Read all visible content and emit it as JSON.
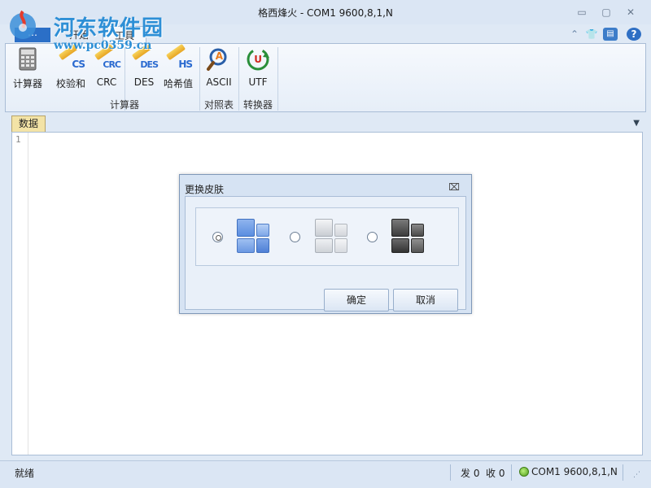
{
  "window": {
    "title": "格西烽火 - COM1  9600,8,1,N",
    "controls": {
      "minimize": "▭",
      "restore": "▢",
      "close": "✕"
    }
  },
  "watermark": {
    "title": "河东软件园",
    "url": "www.pc0359.cn"
  },
  "app_menu": {
    "label": "⋯"
  },
  "ribbon_tabs": [
    {
      "label": "开始",
      "active": false
    },
    {
      "label": "工具",
      "active": true
    }
  ],
  "ribbon_right": [
    {
      "icon": "chevron-up-icon",
      "glyph": "⌃"
    },
    {
      "icon": "shirt-icon",
      "glyph": "👕"
    },
    {
      "icon": "chat-icon",
      "glyph": "▤"
    },
    {
      "icon": "help-icon",
      "glyph": "?"
    }
  ],
  "ribbon": {
    "groups": [
      {
        "label": "计算器"
      },
      {
        "label": "对照表"
      },
      {
        "label": "转换器"
      }
    ],
    "buttons": [
      {
        "label": "计算器",
        "icon": "calculator-icon"
      },
      {
        "label": "校验和",
        "icon": "checksum-icon",
        "icon_text": "CS"
      },
      {
        "label": "CRC",
        "icon": "crc-icon",
        "icon_text": "CRC"
      },
      {
        "label": "DES",
        "icon": "des-icon",
        "icon_text": "DES"
      },
      {
        "label": "哈希值",
        "icon": "hash-icon",
        "icon_text": "HS"
      },
      {
        "label": "ASCII",
        "icon": "ascii-magnifier-icon",
        "icon_text": "A"
      },
      {
        "label": "UTF",
        "icon": "utf-convert-icon",
        "icon_text": "U"
      }
    ]
  },
  "document": {
    "tab_label": "数据",
    "line_numbers": [
      "1"
    ]
  },
  "dialog": {
    "title": "更换皮肤",
    "close_glyph": "⌧",
    "skins": [
      {
        "name": "blue",
        "checked": true,
        "colors": [
          "#5b8ee0",
          "#8fb4ee"
        ]
      },
      {
        "name": "silver",
        "checked": false,
        "colors": [
          "#c9cdd3",
          "#eef0f3"
        ]
      },
      {
        "name": "black",
        "checked": false,
        "colors": [
          "#3c3c3c",
          "#7a7a7a"
        ]
      }
    ],
    "ok_label": "确定",
    "cancel_label": "取消"
  },
  "status": {
    "ready": "就绪",
    "sent": "发 0",
    "received": "收 0",
    "port": "COM1  9600,8,1,N"
  }
}
